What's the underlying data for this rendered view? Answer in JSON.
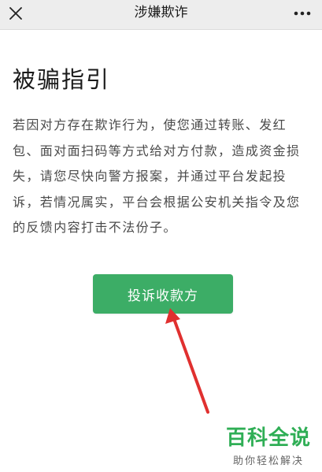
{
  "nav": {
    "title": "涉嫌欺诈",
    "close_icon": "close-icon",
    "more_icon": "more-dots-icon"
  },
  "content": {
    "heading": "被骗指引",
    "paragraph": "若因对方存在欺诈行为，使您通过转账、发红包、面对面扫码等方式给对方付款，造成资金损失，请您尽快向警方报案，并通过平台发起投诉，若情况属实，平台会根据公安机关指令及您的反馈内容打击不法份子。"
  },
  "actions": {
    "complain_label": "投诉收款方"
  },
  "annotation": {
    "arrow_icon": "red-arrow-icon",
    "color": "#e0302f"
  },
  "watermark": {
    "title": "百科全说",
    "subtitle": "助你轻松解决"
  },
  "colors": {
    "accent": "#3cad66",
    "topbar": "#ededed",
    "watermark_green": "#2fae55"
  }
}
